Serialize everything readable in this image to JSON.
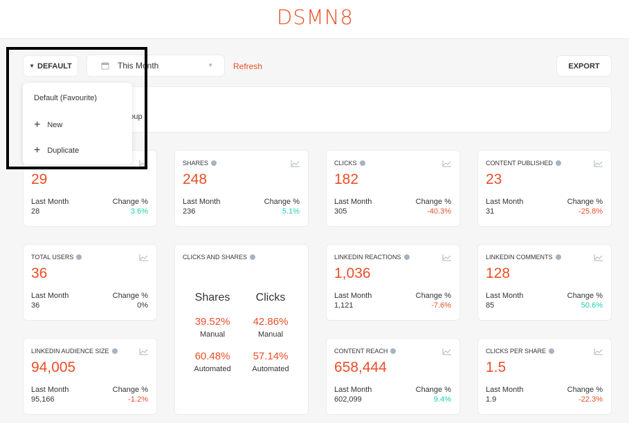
{
  "header": {
    "logo": "DSMN8"
  },
  "toolbar": {
    "default_label": "DEFAULT",
    "date_range": "This Month",
    "refresh": "Refresh",
    "export": "EXPORT"
  },
  "info": {
    "text": "l group"
  },
  "dropdown": {
    "items": [
      "Default (Favourite)",
      "New",
      "Duplicate"
    ]
  },
  "cards": [
    {
      "title": "",
      "value": "29",
      "last_month_label": "Last Month",
      "last_month": "28",
      "change_label": "Change %",
      "change": "3.6%"
    },
    {
      "title": "SHARES",
      "value": "248",
      "last_month_label": "Last Month",
      "last_month": "236",
      "change_label": "Change %",
      "change": "5.1%"
    },
    {
      "title": "CLICKS",
      "value": "182",
      "last_month_label": "Last Month",
      "last_month": "305",
      "change_label": "Change %",
      "change": "-40.3%"
    },
    {
      "title": "CONTENT PUBLISHED",
      "value": "23",
      "last_month_label": "Last Month",
      "last_month": "31",
      "change_label": "Change %",
      "change": "-25.8%"
    },
    {
      "title": "TOTAL USERS",
      "value": "36",
      "last_month_label": "Last Month",
      "last_month": "36",
      "change_label": "Change %",
      "change": "0%"
    },
    {
      "title": "LINKEDIN REACTIONS",
      "value": "1,036",
      "last_month_label": "Last Month",
      "last_month": "1,121",
      "change_label": "Change %",
      "change": "-7.6%"
    },
    {
      "title": "LINKEDIN COMMENTS",
      "value": "128",
      "last_month_label": "Last Month",
      "last_month": "85",
      "change_label": "Change %",
      "change": "50.6%"
    },
    {
      "title": "LINKEDIN AUDIENCE SIZE",
      "value": "94,005",
      "last_month_label": "Last Month",
      "last_month": "95,166",
      "change_label": "Change %",
      "change": "-1.2%"
    },
    {
      "title": "CONTENT REACH",
      "value": "658,444",
      "last_month_label": "Last Month",
      "last_month": "602,099",
      "change_label": "Change %",
      "change": "9.4%"
    },
    {
      "title": "CLICKS PER SHARE",
      "value": "1.5",
      "last_month_label": "Last Month",
      "last_month": "1.9",
      "change_label": "Change %",
      "change": "-22.3%"
    }
  ],
  "clicks_and_shares": {
    "title": "CLICKS AND SHARES",
    "columns": [
      {
        "heading": "Shares",
        "manual_pct": "39.52%",
        "manual_label": "Manual",
        "auto_pct": "60.48%",
        "auto_label": "Automated"
      },
      {
        "heading": "Clicks",
        "manual_pct": "42.86%",
        "manual_label": "Manual",
        "auto_pct": "57.14%",
        "auto_label": "Automated"
      }
    ]
  }
}
